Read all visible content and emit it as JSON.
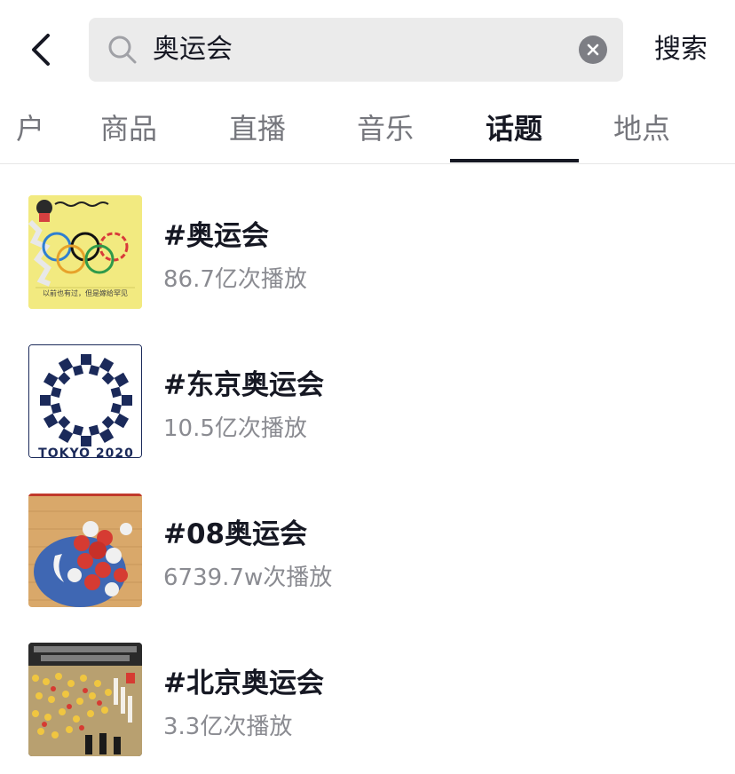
{
  "search": {
    "query": "奥运会",
    "submit_label": "搜索"
  },
  "tabs": [
    {
      "label": "户",
      "active": false
    },
    {
      "label": "商品",
      "active": false
    },
    {
      "label": "直播",
      "active": false
    },
    {
      "label": "音乐",
      "active": false
    },
    {
      "label": "话题",
      "active": true
    },
    {
      "label": "地点",
      "active": false
    }
  ],
  "results": [
    {
      "title": "#奥运会",
      "plays": "86.7亿次播放",
      "thumb_icon": "olympic-rings-thumbnail",
      "thumb_caption": "以前也有过，但是嫁给罕见"
    },
    {
      "title": "#东京奥运会",
      "plays": "10.5亿次播放",
      "thumb_icon": "tokyo-2020-emblem-thumbnail",
      "thumb_caption": "TOKYO 2020"
    },
    {
      "title": "#08奥运会",
      "plays": "6739.7w次播放",
      "thumb_icon": "basketball-team-thumbnail"
    },
    {
      "title": "#北京奥运会",
      "plays": "3.3亿次播放",
      "thumb_icon": "opening-ceremony-thumbnail"
    }
  ],
  "colors": {
    "text_primary": "#161823",
    "text_secondary": "#8a8b91",
    "search_bg": "#ebebeb",
    "tab_inactive": "#75767c"
  }
}
